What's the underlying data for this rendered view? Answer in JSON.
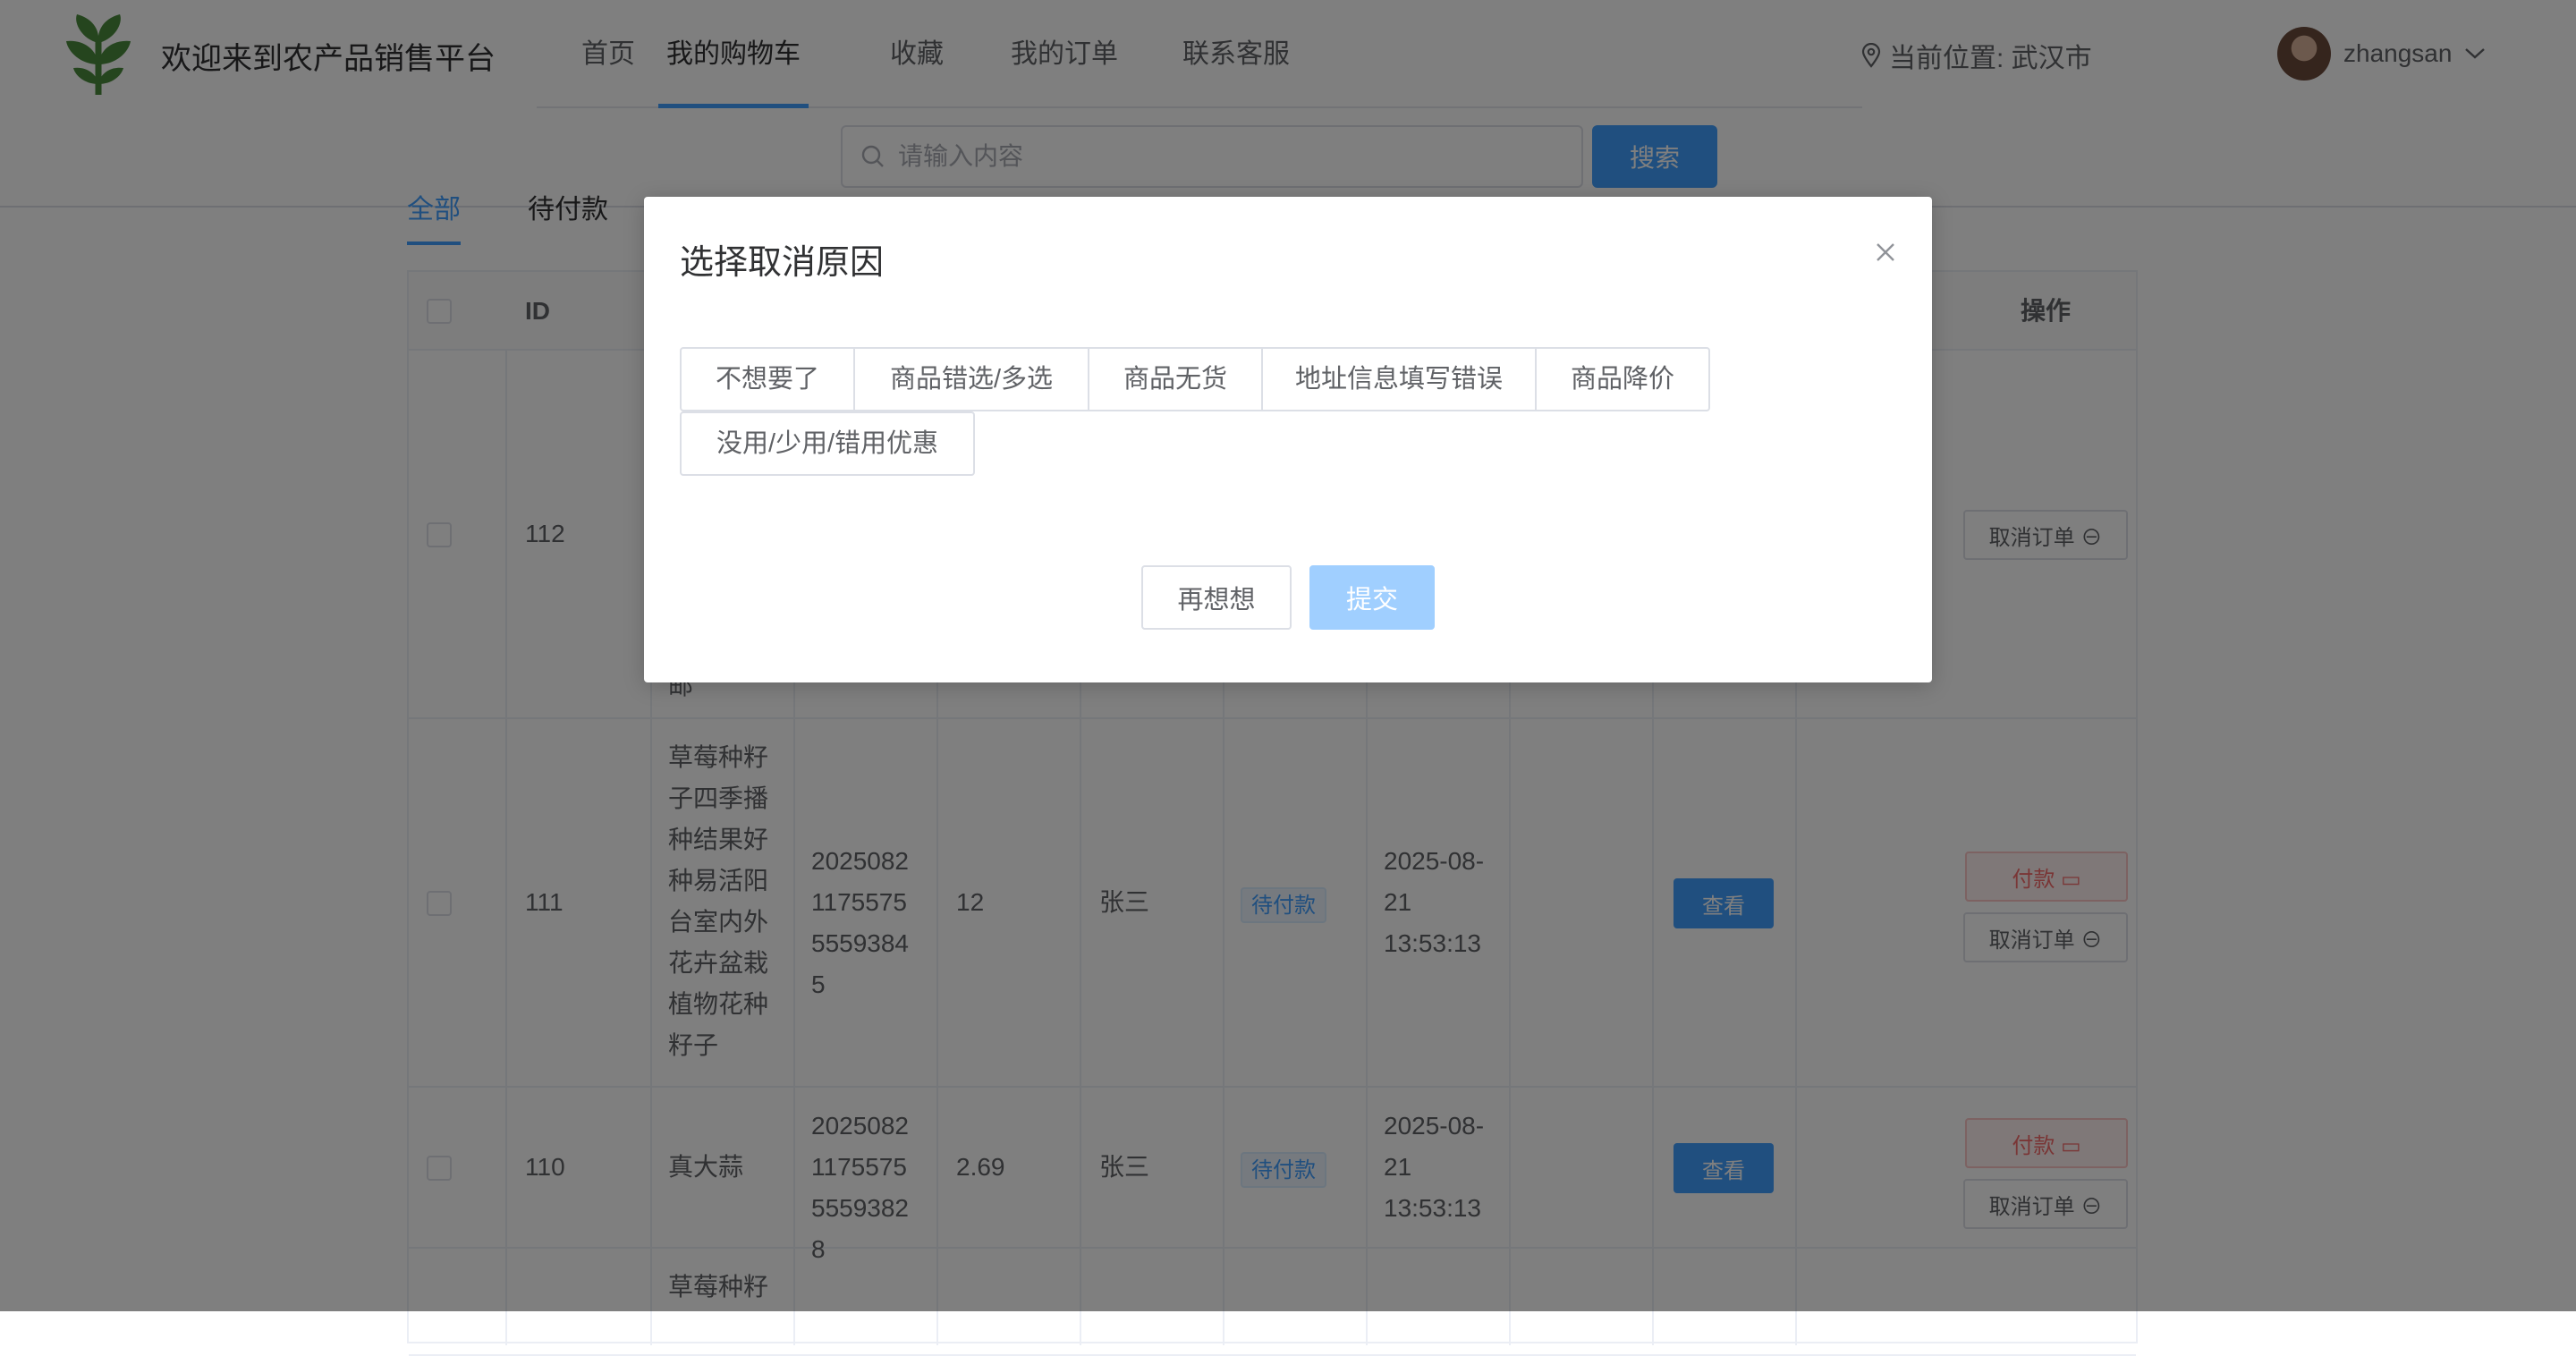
{
  "header": {
    "site_title": "欢迎来到农产品销售平台",
    "nav": [
      "首页",
      "我的购物车",
      "收藏",
      "我的订单",
      "联系客服"
    ],
    "active_nav": "我的购物车",
    "location": "当前位置: 武汉市",
    "username": "zhangsan"
  },
  "search": {
    "placeholder": "请输入内容",
    "button": "搜索"
  },
  "tabs": [
    "全部",
    "待付款"
  ],
  "table": {
    "columns": [
      "ID",
      "操作"
    ],
    "rows": [
      {
        "id": "112",
        "action_cancel": "取消订单"
      },
      {
        "id": "111",
        "product": "草莓种籽子四季播种结果好种易活阳台室内外花卉盆栽植物花种籽子",
        "order_no": "2025082117557555593845",
        "amount": "12",
        "buyer": "张三",
        "status": "待付款",
        "time": "2025-08-21 13:53:13",
        "view": "查看",
        "pay": "付款",
        "action_cancel": "取消订单"
      },
      {
        "id": "110",
        "product": "真大蒜",
        "order_no": "2025082117557555593828",
        "amount": "2.69",
        "buyer": "张三",
        "status": "待付款",
        "time": "2025-08-21 13:53:13",
        "view": "查看",
        "pay": "付款",
        "action_cancel": "取消订单"
      },
      {
        "product": "草莓种籽"
      }
    ],
    "row112_partial": "邮"
  },
  "dialog": {
    "title": "选择取消原因",
    "reasons": [
      "不想要了",
      "商品错选/多选",
      "商品无货",
      "地址信息填写错误",
      "商品降价",
      "没用/少用/错用优惠"
    ],
    "cancel_button": "再想想",
    "submit_button": "提交"
  },
  "colors": {
    "primary": "#409eff",
    "primary_disabled": "#a0cfff",
    "danger": "#f56c6c",
    "logo_green": "#4a8a3c"
  }
}
